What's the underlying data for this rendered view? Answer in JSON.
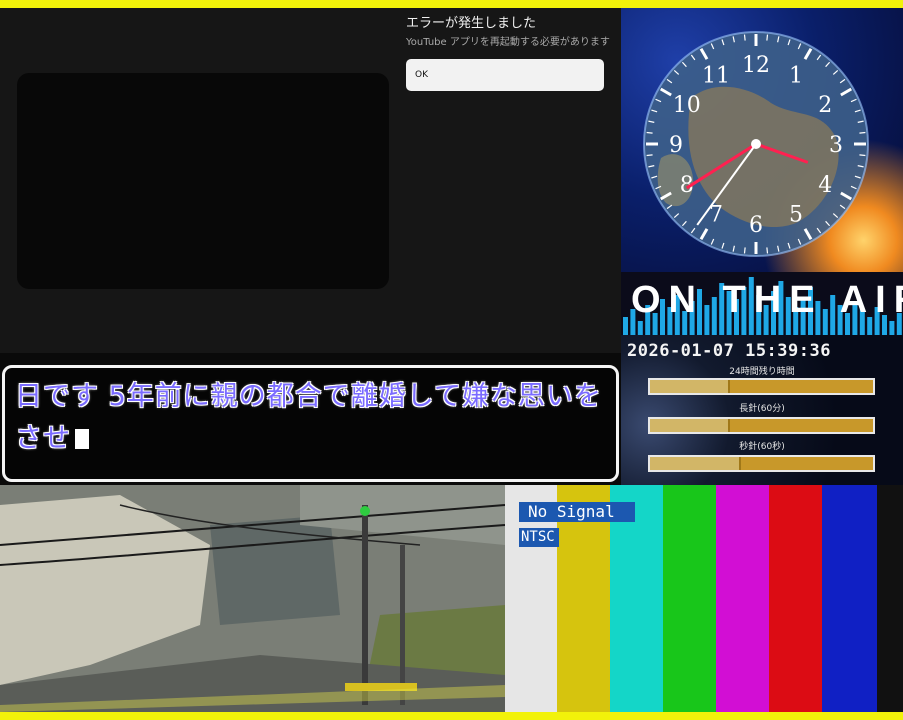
{
  "youtube_error": {
    "title": "エラーが発生しました",
    "message": "YouTube アプリを再起動する必要があります",
    "ok_label": "OK"
  },
  "clock": {
    "numerals": [
      "12",
      "1",
      "2",
      "3",
      "4",
      "5",
      "6",
      "7",
      "8",
      "9",
      "10",
      "11"
    ],
    "time_shown": "15:39:36"
  },
  "on_air": {
    "text": "ON THE AIR"
  },
  "timer": {
    "datetime": "2026-01-07 15:39:36",
    "bars": [
      {
        "label": "24時間残り時間",
        "fraction": 0.35
      },
      {
        "label": "長針(60分)",
        "fraction": 0.35
      },
      {
        "label": "秒針(60秒)",
        "fraction": 0.4
      }
    ]
  },
  "captions": {
    "line1": "日です 5年前に親の都合で離婚して嫌な思いを",
    "line2": "させ"
  },
  "test_pattern": {
    "status": "No Signal",
    "standard": "NTSC",
    "colors": [
      "#e6e6e6",
      "#d6c40e",
      "#14d6c8",
      "#18c61a",
      "#d20ed4",
      "#dc0c14",
      "#1020c4",
      "#111111"
    ]
  }
}
